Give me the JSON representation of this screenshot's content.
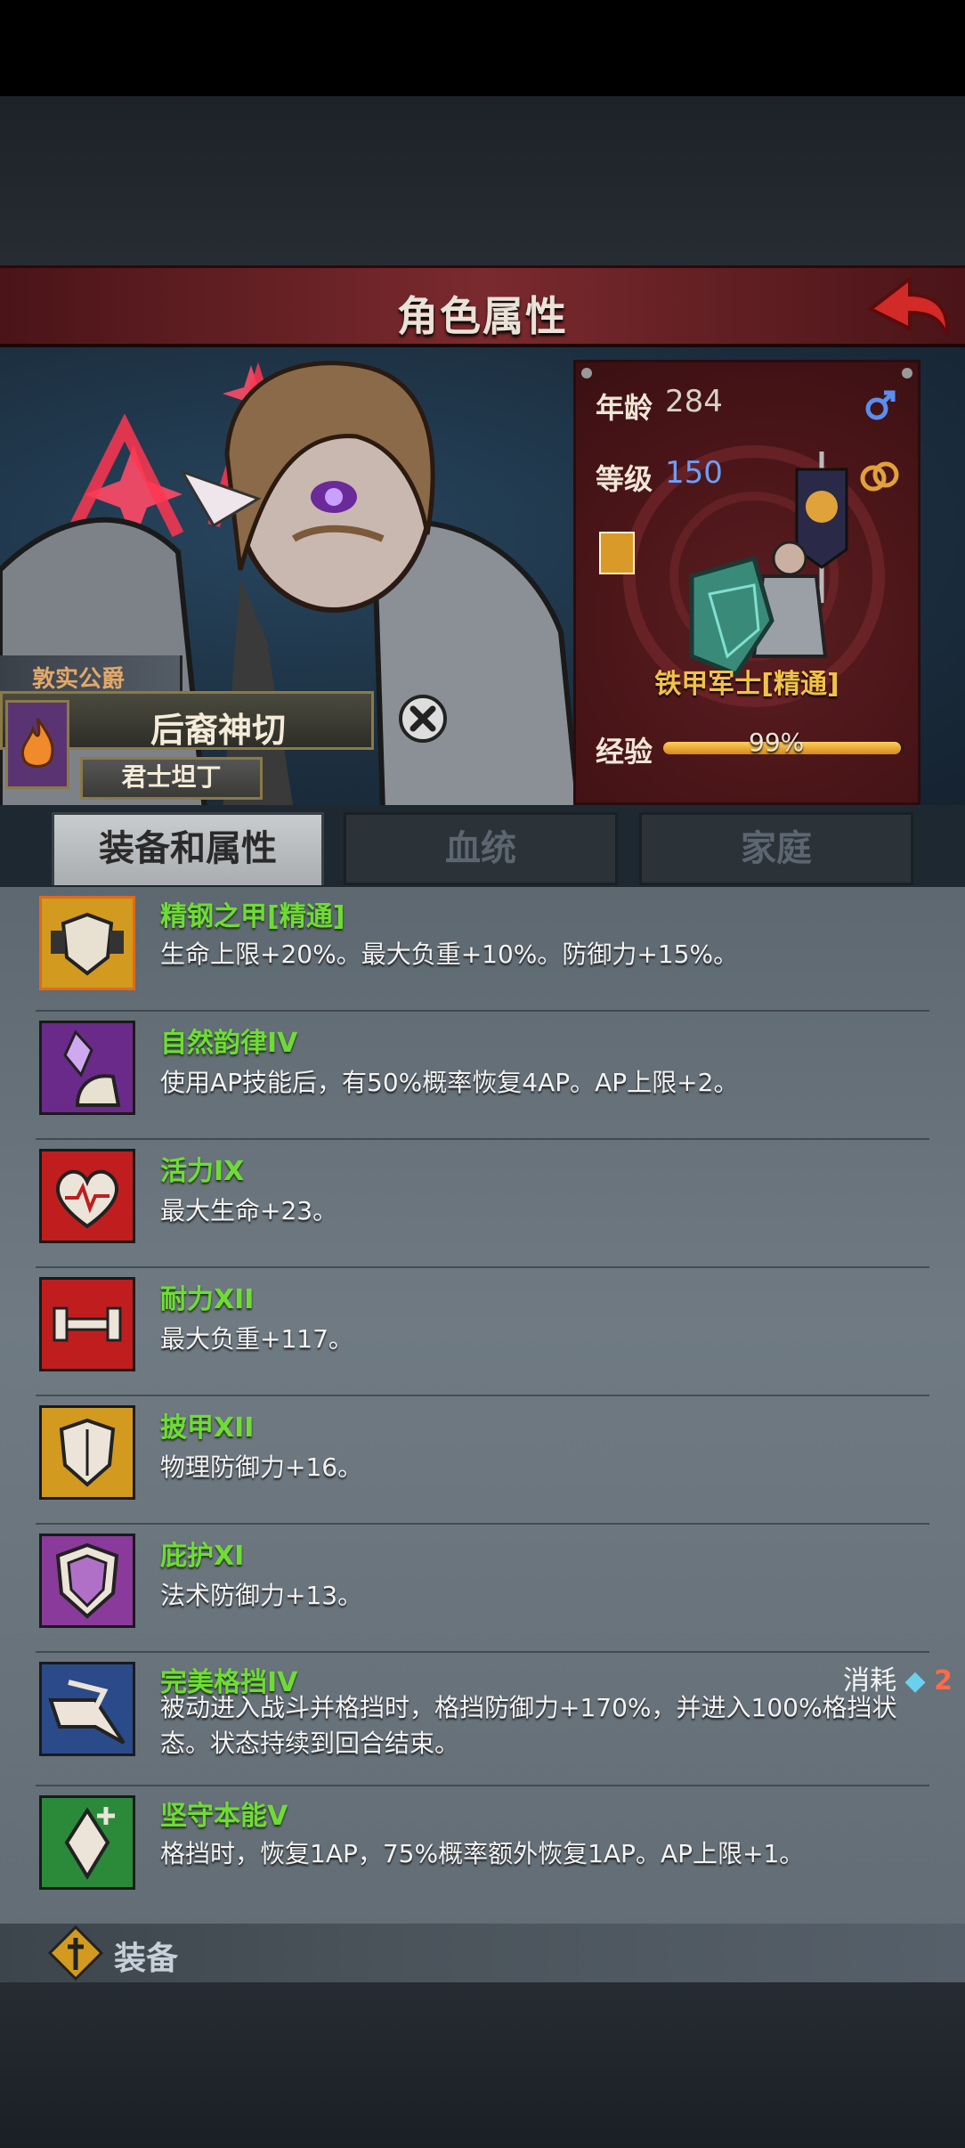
{
  "header": {
    "title": "角色属性"
  },
  "character": {
    "title_badge": "敦实公爵",
    "name": "后裔神切",
    "class": "君士坦丁"
  },
  "info": {
    "age_label": "年龄",
    "age_value": "284",
    "level_label": "等级",
    "level_value": "150",
    "unit_name": "铁甲军士[精通]",
    "exp_label": "经验",
    "exp_percent": "99%",
    "exp_fraction": 0.99
  },
  "tabs": [
    {
      "label": "装备和属性",
      "active": true
    },
    {
      "label": "血统",
      "active": false
    },
    {
      "label": "家庭",
      "active": false
    }
  ],
  "items": [
    {
      "name": "精钢之甲[精通]",
      "desc": "生命上限+20%。最大负重+10%。防御力+15%。",
      "icon": "steel-armor-icon"
    },
    {
      "name": "自然韵律IV",
      "desc": "使用AP技能后，有50%概率恢复4AP。AP上限+2。",
      "icon": "natural-rhythm-icon"
    },
    {
      "name": "活力IX",
      "desc": "最大生命+23。",
      "icon": "heart-icon"
    },
    {
      "name": "耐力XII",
      "desc": "最大负重+117。",
      "icon": "dumbbell-icon"
    },
    {
      "name": "披甲XII",
      "desc": "物理防御力+16。",
      "icon": "shield-icon"
    },
    {
      "name": "庇护XI",
      "desc": "法术防御力+13。",
      "icon": "magic-shield-icon"
    },
    {
      "name": "完美格挡IV",
      "desc": "被动进入战斗并格挡时，格挡防御力+170%，并进入100%格挡状态。状态持续到回合结束。",
      "icon": "parry-icon",
      "cost_label": "消耗",
      "cost_value": "2"
    },
    {
      "name": "坚守本能V",
      "desc": "格挡时，恢复1AP，75%概率额外恢复1AP。AP上限+1。",
      "icon": "crystal-icon"
    }
  ],
  "equip_section": {
    "label": "装备"
  },
  "colors": {
    "header": "#7a2a2e",
    "item_name": "#6fdc36",
    "unit_name": "#f1c24a",
    "cost_num": "#ff6a4a",
    "level_value": "#6aa0ff"
  }
}
